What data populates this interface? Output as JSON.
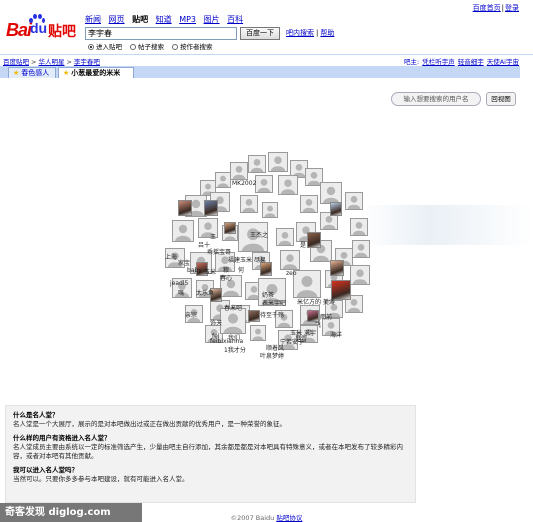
{
  "top_links": [
    "百度首页",
    "登录"
  ],
  "logo": {
    "bai": "Bai",
    "du": "du",
    "tieba": "贴吧"
  },
  "nav": [
    {
      "label": "新闻",
      "current": false
    },
    {
      "label": "网页",
      "current": false
    },
    {
      "label": "贴吧",
      "current": true
    },
    {
      "label": "知道",
      "current": false
    },
    {
      "label": "MP3",
      "current": false
    },
    {
      "label": "图片",
      "current": false
    },
    {
      "label": "百科",
      "current": false
    }
  ],
  "search": {
    "value": "李宇春",
    "button": "百度一下",
    "links": [
      "吧内搜索",
      "帮助"
    ],
    "options": [
      {
        "label": "进入贴吧",
        "checked": true
      },
      {
        "label": "帖子搜索",
        "checked": false
      },
      {
        "label": "按作者搜索",
        "checked": false
      }
    ]
  },
  "breadcrumb": [
    "百度贴吧",
    "华人明星",
    "李宇春吧"
  ],
  "breadcrumb_right": {
    "label": "吧主:",
    "owners": [
      "凭栏听宇声",
      "轻音细宇",
      "天使Ai宇宙"
    ]
  },
  "tabs": [
    "春色感人",
    "小葱最爱的米米"
  ],
  "cloud": {
    "search_placeholder": "输入想要搜索的用户名",
    "button": "回视图",
    "names": [
      "MK2002",
      "王",
      "吕十",
      "乖摇宝哥",
      "福建玉米 尽易",
      "王杰之",
      "是",
      "上海",
      "家宝",
      "粮",
      "何",
      "baby",
      "玉米",
      "zeo",
      "春心",
      "jeadl5",
      "嗎",
      "奶茶",
      "表米宇吧",
      "春米吧",
      "太乐鱼",
      "亲宗",
      "饰天",
      "米亿方的 美涛",
      "待至千殇",
      "雨前",
      "fei",
      "我们",
      "飞",
      "玉米 求宇",
      "feibixianna",
      "顺着风",
      "是雪",
      "海洋",
      "宁若安子",
      "1我才分",
      "叶泉梦婷"
    ]
  },
  "faq": [
    {
      "q": "什么是名人堂？",
      "a": "名人堂是一个大展厅，展示的是对本吧做出过或正在做出贡献的优秀用户，是一种荣誉的象征。"
    },
    {
      "q": "什么样的用户有资格进入名人堂？",
      "a": "名人堂成员主要由系统以一定的标准筛选产生，少量由吧主自行添加，其余都是都是对本吧具有特殊意义，或者在本吧发布了较多精彩内容，或者对本吧有其他贡献。"
    },
    {
      "q": "我可以进入名人堂吗？",
      "a": "当然可以。只要你多多参与本吧建设，就有可能进入名人堂。"
    }
  ],
  "footer": {
    "copy": "©2007 Baidu",
    "link": "贴吧协议"
  },
  "watermark": "奇客发现 diglog.com"
}
